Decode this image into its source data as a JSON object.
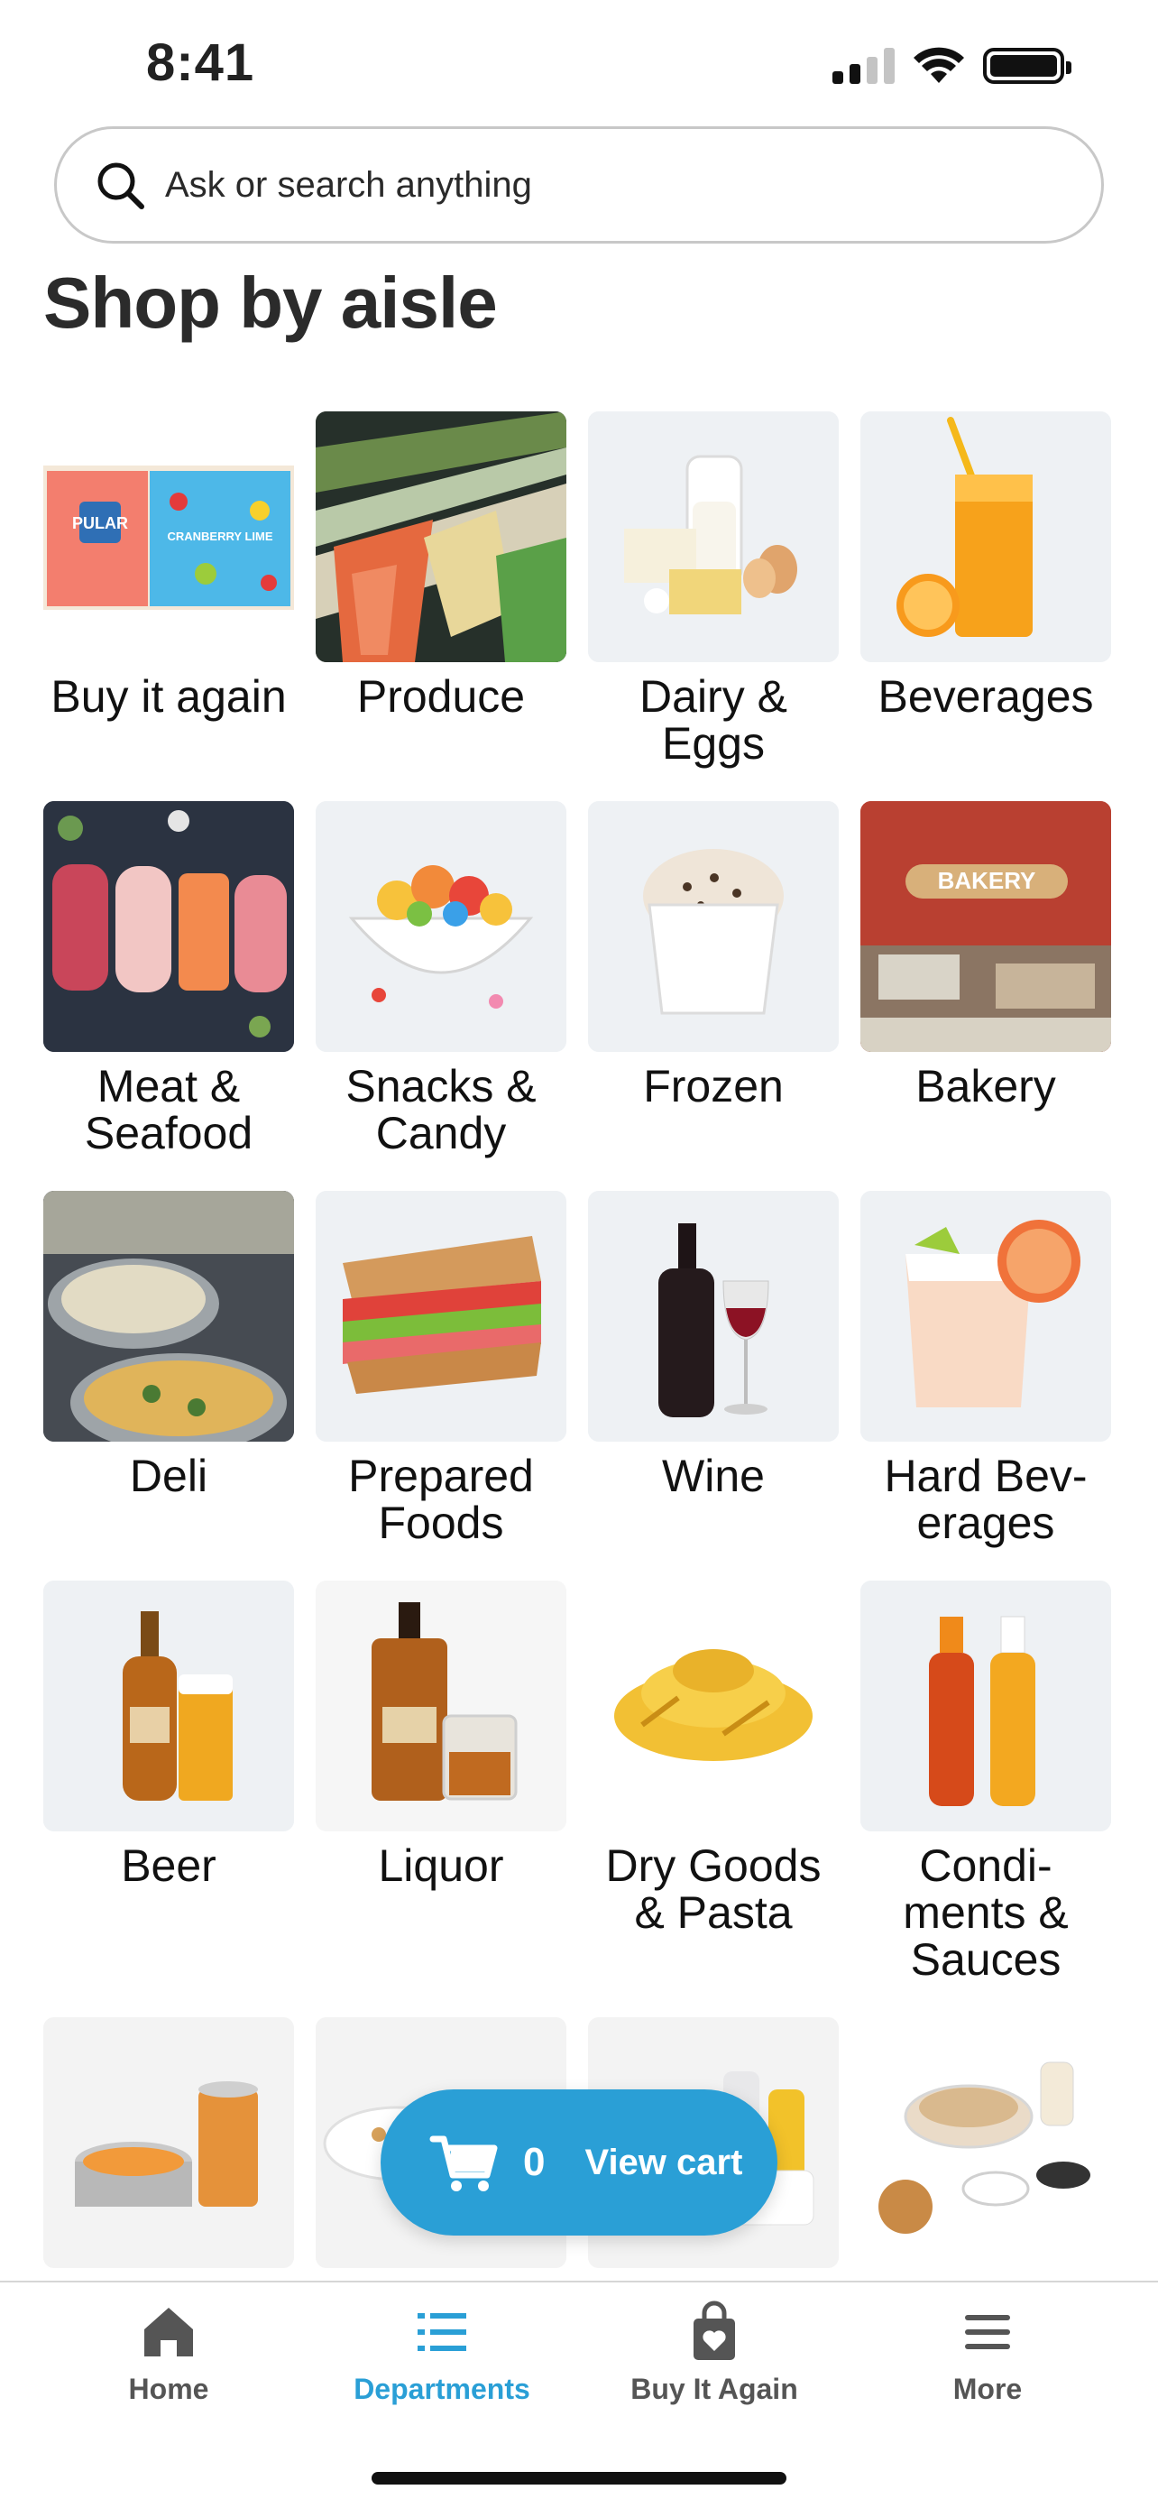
{
  "status_bar": {
    "time": "8:41"
  },
  "search": {
    "placeholder": "Ask or search anything"
  },
  "page_title": "Shop by aisle",
  "aisles": [
    {
      "label": "Buy it again",
      "icon": "buy-it-again-image"
    },
    {
      "label": "Produce",
      "icon": "produce-image"
    },
    {
      "label": "Dairy & Eggs",
      "icon": "dairy-eggs-image"
    },
    {
      "label": "Beverages",
      "icon": "beverages-image"
    },
    {
      "label": "Meat & Seafood",
      "icon": "meat-seafood-image"
    },
    {
      "label": "Snacks & Candy",
      "icon": "snacks-candy-image"
    },
    {
      "label": "Frozen",
      "icon": "frozen-image"
    },
    {
      "label": "Bakery",
      "icon": "bakery-image"
    },
    {
      "label": "Deli",
      "icon": "deli-image"
    },
    {
      "label": "Prepared Foods",
      "icon": "prepared-foods-image"
    },
    {
      "label": "Wine",
      "icon": "wine-image"
    },
    {
      "label": "Hard Bev-erages",
      "icon": "hard-beverages-image"
    },
    {
      "label": "Beer",
      "icon": "beer-image"
    },
    {
      "label": "Liquor",
      "icon": "liquor-image"
    },
    {
      "label": "Dry Goods & Pasta",
      "icon": "dry-goods-pasta-image"
    },
    {
      "label": "Condi-ments & Sauces",
      "icon": "condiments-sauces-image"
    },
    {
      "label": "",
      "icon": "canned-goods-image"
    },
    {
      "label": "",
      "icon": "breakfast-image"
    },
    {
      "label": "",
      "icon": "household-image"
    },
    {
      "label": "",
      "icon": "baking-image"
    }
  ],
  "cart": {
    "count": "0",
    "label": "View cart"
  },
  "bottom_nav": [
    {
      "label": "Home",
      "icon": "home-icon",
      "active": false
    },
    {
      "label": "Departments",
      "icon": "list-icon",
      "active": true
    },
    {
      "label": "Buy It Again",
      "icon": "bag-heart-icon",
      "active": false
    },
    {
      "label": "More",
      "icon": "menu-icon",
      "active": false
    }
  ],
  "colors": {
    "accent": "#2a9fd6",
    "text": "#111111",
    "tile_bg": "#eef2f6"
  },
  "bakery_sign": "BAKERY",
  "product_box_text": "CRANBERRY LIME"
}
